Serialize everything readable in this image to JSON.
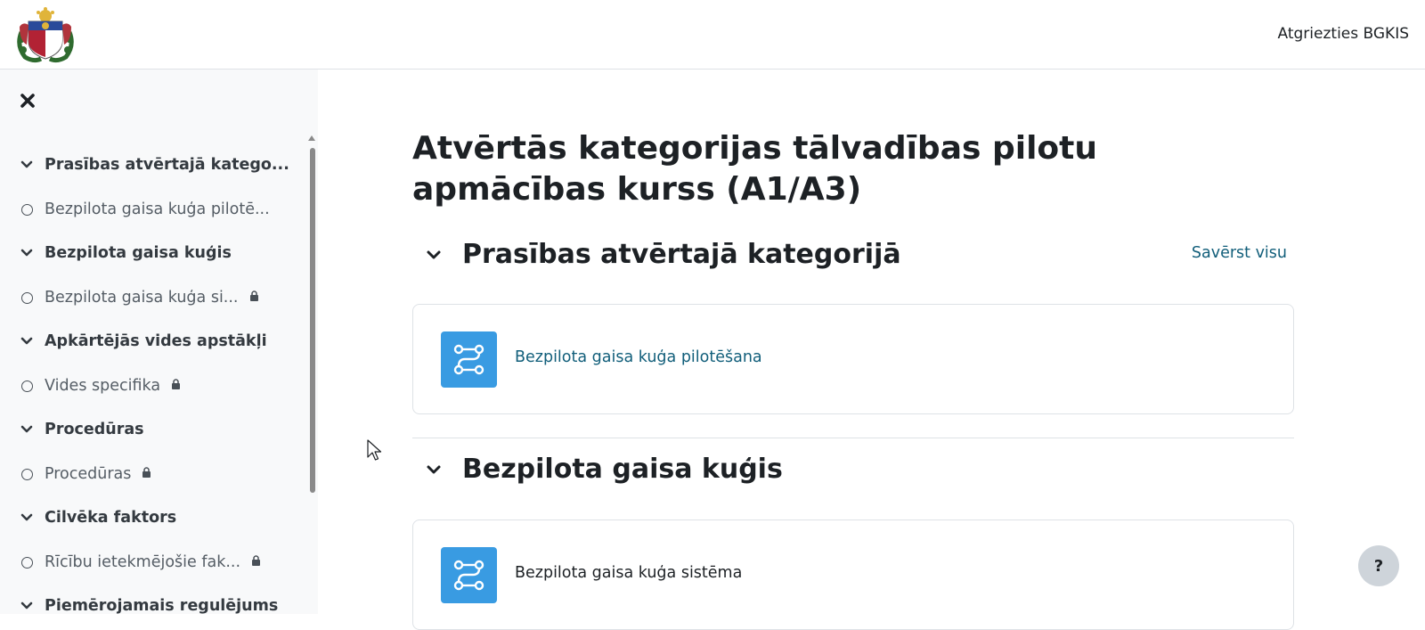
{
  "navbar": {
    "logo_alt": "Latvijas valsts ģerbonis",
    "return_label": "Atgriezties BGKIS"
  },
  "sidebar": {
    "items": [
      {
        "type": "section",
        "label": "Prasības atvērtajā katego...",
        "locked": false
      },
      {
        "type": "item",
        "label": "Bezpilota gaisa kuģa pilotē...",
        "locked": false
      },
      {
        "type": "section",
        "label": "Bezpilota gaisa kuģis",
        "locked": false
      },
      {
        "type": "item",
        "label": "Bezpilota gaisa kuģa si...",
        "locked": true
      },
      {
        "type": "section",
        "label": "Apkārtējās vides apstākļi",
        "locked": false
      },
      {
        "type": "item",
        "label": "Vides specifika",
        "locked": true
      },
      {
        "type": "section",
        "label": "Procedūras",
        "locked": false
      },
      {
        "type": "item",
        "label": "Procedūras",
        "locked": true
      },
      {
        "type": "section",
        "label": "Cilvēka faktors",
        "locked": false
      },
      {
        "type": "item",
        "label": "Rīcību ietekmējošie fak...",
        "locked": true
      },
      {
        "type": "section",
        "label": "Piemērojamais regulējums",
        "locked": false
      }
    ]
  },
  "main": {
    "title": "Atvērtās kategorijas tālvadības pilotu apmācības kurss (A1/A3)",
    "collapse_all": "Savērst visu",
    "sections": [
      {
        "title": "Prasības atvērtajā kategorijā",
        "activity": "Bezpilota gaisa kuģa pilotēšana"
      },
      {
        "title": "Bezpilota gaisa kuģis",
        "activity": "Bezpilota gaisa kuģa sistēma"
      }
    ]
  },
  "help": {
    "label": "?"
  },
  "colors": {
    "link": "#115e7a",
    "activity_icon_bg": "#399be2",
    "sidebar_bg": "#f8f9fa"
  }
}
